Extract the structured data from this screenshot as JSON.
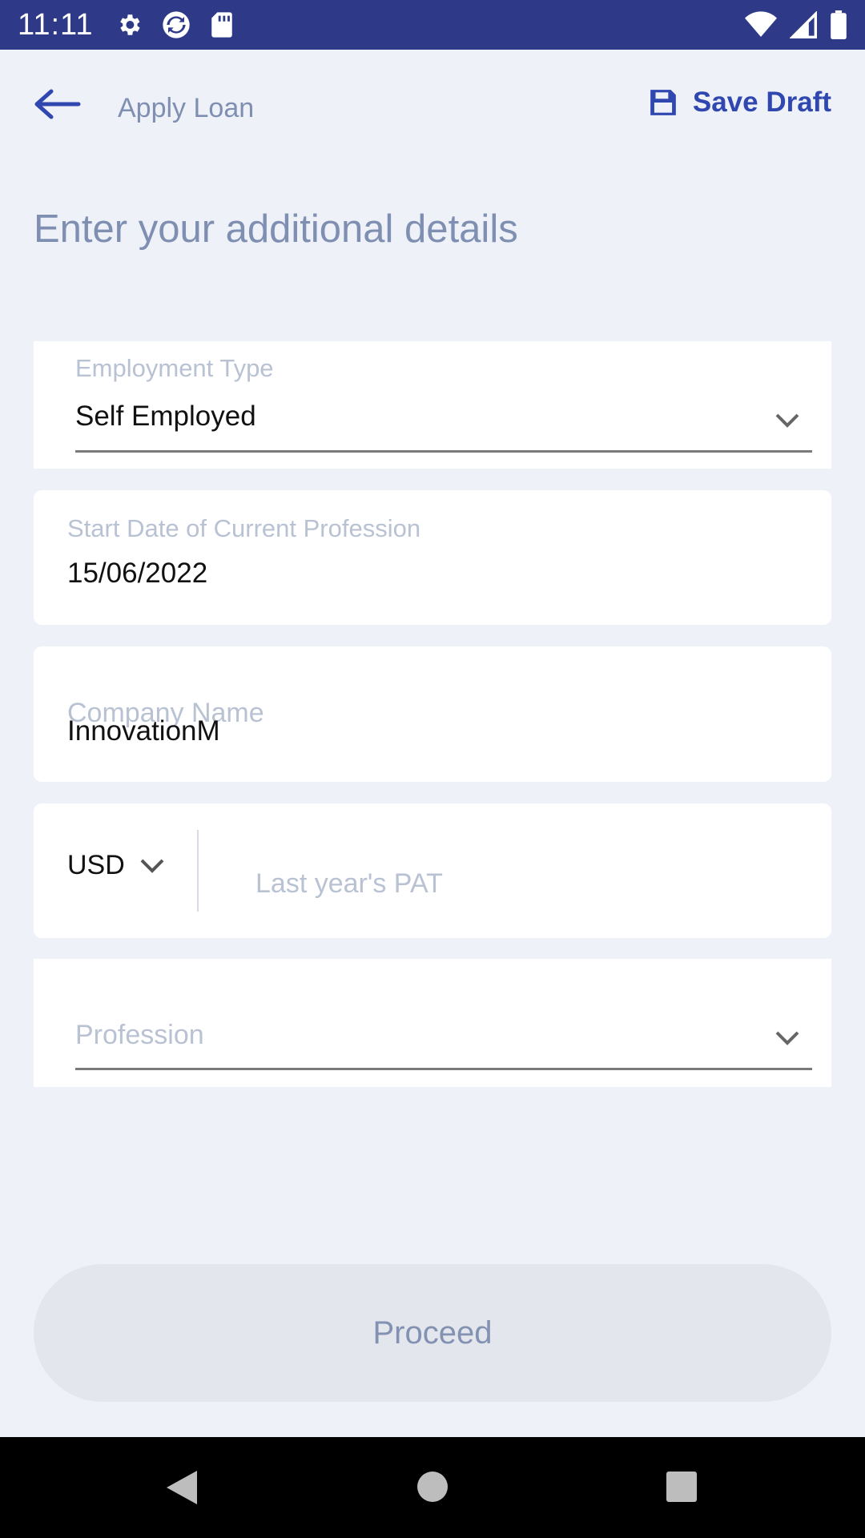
{
  "status_bar": {
    "time": "11:11",
    "icons_left": [
      "gear-icon",
      "sync-icon",
      "sd-card-icon"
    ],
    "icons_right": [
      "wifi-icon",
      "signal-icon",
      "battery-icon"
    ]
  },
  "app_bar": {
    "title": "Apply Loan",
    "save_draft_label": "Save Draft",
    "colors": {
      "accent": "#3047b0",
      "status_bar": "#2e3a87"
    }
  },
  "form": {
    "section_title": "Enter your additional details",
    "employment_type": {
      "label": "Employment Type",
      "value": "Self Employed"
    },
    "start_date": {
      "label": "Start Date of Current Profession",
      "value": "15/06/2022"
    },
    "company_name": {
      "label": "Company Name",
      "value": "InnovationM"
    },
    "pat": {
      "currency": "USD",
      "placeholder": "Last year's PAT"
    },
    "profession": {
      "placeholder": "Profession"
    }
  },
  "proceed_label": "Proceed"
}
